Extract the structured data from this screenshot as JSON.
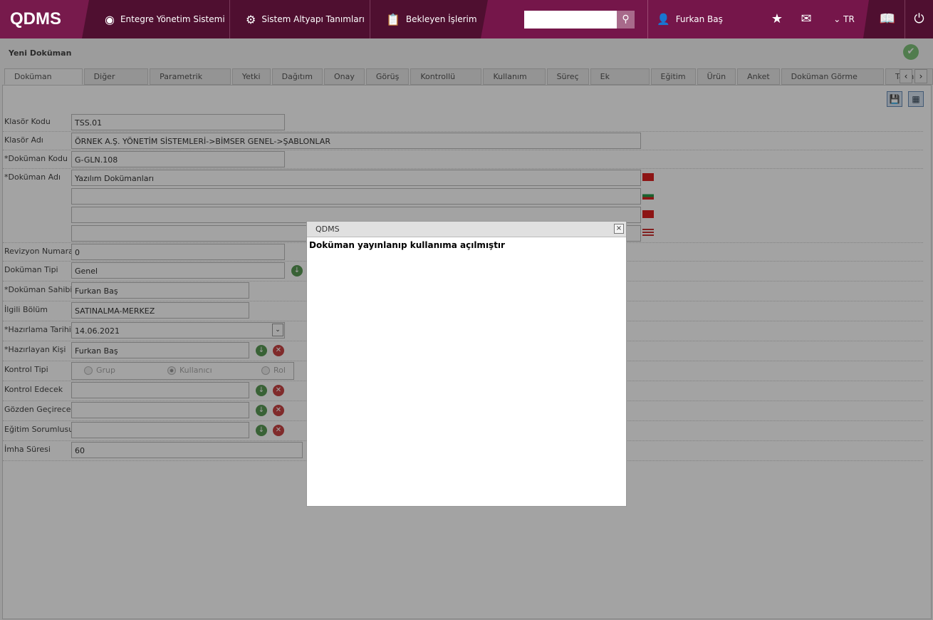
{
  "header": {
    "logo": "QDMS",
    "nav": [
      "Entegre Yönetim Sistemi",
      "Sistem Altyapı Tanımları",
      "Bekleyen İşlerim"
    ],
    "search_placeholder": "",
    "user": "Furkan Baş",
    "lang": "TR"
  },
  "page": {
    "title": "Yeni Doküman"
  },
  "tabs": [
    "Doküman Bilgileri",
    "Diğer Bilgileri",
    "Parametrik Alanlar",
    "Yetki",
    "Dağıtım",
    "Onay",
    "Görüş",
    "Kontrollü Kopya",
    "Kullanım Yeri",
    "Süreç",
    "Ek Dosyalar",
    "Eğitim",
    "Ürün",
    "Anket",
    "Doküman Görme Formatı",
    "Tarihçe"
  ],
  "form": {
    "klasor_kodu": {
      "label": "Klasör Kodu",
      "value": "TSS.01"
    },
    "klasor_adi": {
      "label": "Klasör Adı",
      "value": "ÖRNEK A.Ş. YÖNETİM SİSTEMLERİ->BİMSER GENEL->ŞABLONLAR"
    },
    "dokuman_kodu": {
      "label": "*Doküman Kodu",
      "value": "G-GLN.108"
    },
    "dokuman_adi": {
      "label": "*Doküman Adı",
      "value": "Yazılım Dokümanları"
    },
    "revizyon": {
      "label": "Revizyon Numarası",
      "value": "0"
    },
    "tipi": {
      "label": "Doküman Tipi",
      "value": "Genel"
    },
    "sahibi": {
      "label": "*Doküman Sahibi",
      "value": "Furkan Baş"
    },
    "bolum": {
      "label": "İlgili Bölüm",
      "value": "SATINALMA-MERKEZ"
    },
    "tarih": {
      "label": "*Hazırlama Tarihi",
      "value": "14.06.2021"
    },
    "hazirlayan": {
      "label": "*Hazırlayan Kişi",
      "value": "Furkan Baş"
    },
    "kontrol_tipi": {
      "label": "Kontrol Tipi",
      "options": [
        "Grup",
        "Kullanıcı",
        "Rol"
      ],
      "selected": "Kullanıcı"
    },
    "kontrol_edecek": {
      "label": "Kontrol Edecek",
      "value": ""
    },
    "gozden": {
      "label": "Gözden Geçirecek",
      "value": ""
    },
    "egitim": {
      "label": "Eğitim Sorumlusu",
      "value": ""
    },
    "imha": {
      "label": "İmha Süresi",
      "value": "60"
    }
  },
  "dialog": {
    "title": "QDMS",
    "message": "Doküman yayınlanıp kullanıma açılmıştır",
    "close": "×"
  }
}
